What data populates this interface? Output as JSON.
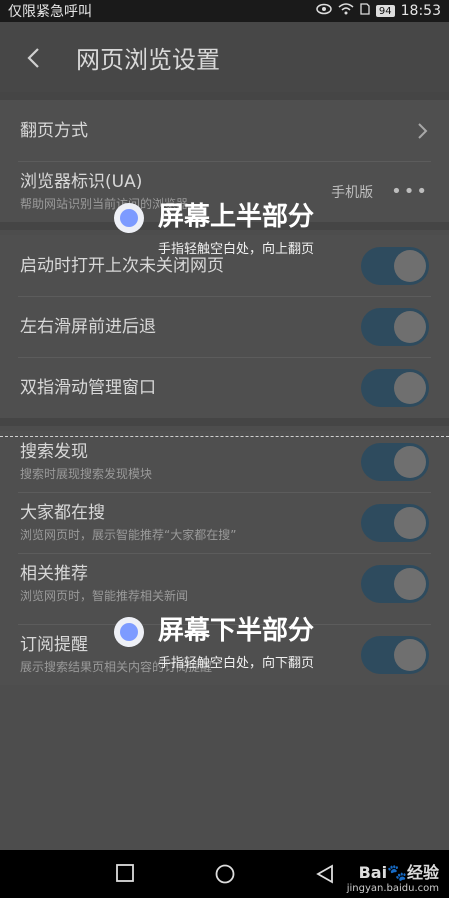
{
  "status": {
    "left_text": "仅限紧急呼叫",
    "battery": "94",
    "time": "18:53"
  },
  "header": {
    "title": "网页浏览设置"
  },
  "group1": {
    "page_turn": {
      "label": "翻页方式"
    },
    "ua": {
      "label": "浏览器标识(UA)",
      "sub": "帮助网站识别当前访问的浏览器",
      "value": "手机版",
      "more": "•••"
    }
  },
  "group2": {
    "items": [
      {
        "label": "启动时打开上次未关闭网页"
      },
      {
        "label": "左右滑屏前进后退"
      },
      {
        "label": "双指滑动管理窗口"
      }
    ]
  },
  "group3": {
    "items": [
      {
        "label": "搜索发现",
        "sub": "搜索时展现搜索发现模块"
      },
      {
        "label": "大家都在搜",
        "sub": "浏览网页时，展示智能推荐“大家都在搜”"
      },
      {
        "label": "相关推荐",
        "sub": "浏览网页时，智能推荐相关新闻"
      },
      {
        "label": "订阅提醒",
        "sub": "展示搜索结果页相关内容的订阅提醒"
      }
    ]
  },
  "hints": {
    "top": {
      "title": "屏幕上半部分",
      "sub": "手指轻触空白处，向上翻页"
    },
    "bottom": {
      "title": "屏幕下半部分",
      "sub": "手指轻触空白处，向下翻页"
    }
  },
  "watermark": {
    "brand": "Bai",
    "brand_suffix": "经验",
    "url": "jingyan.baidu.com"
  }
}
